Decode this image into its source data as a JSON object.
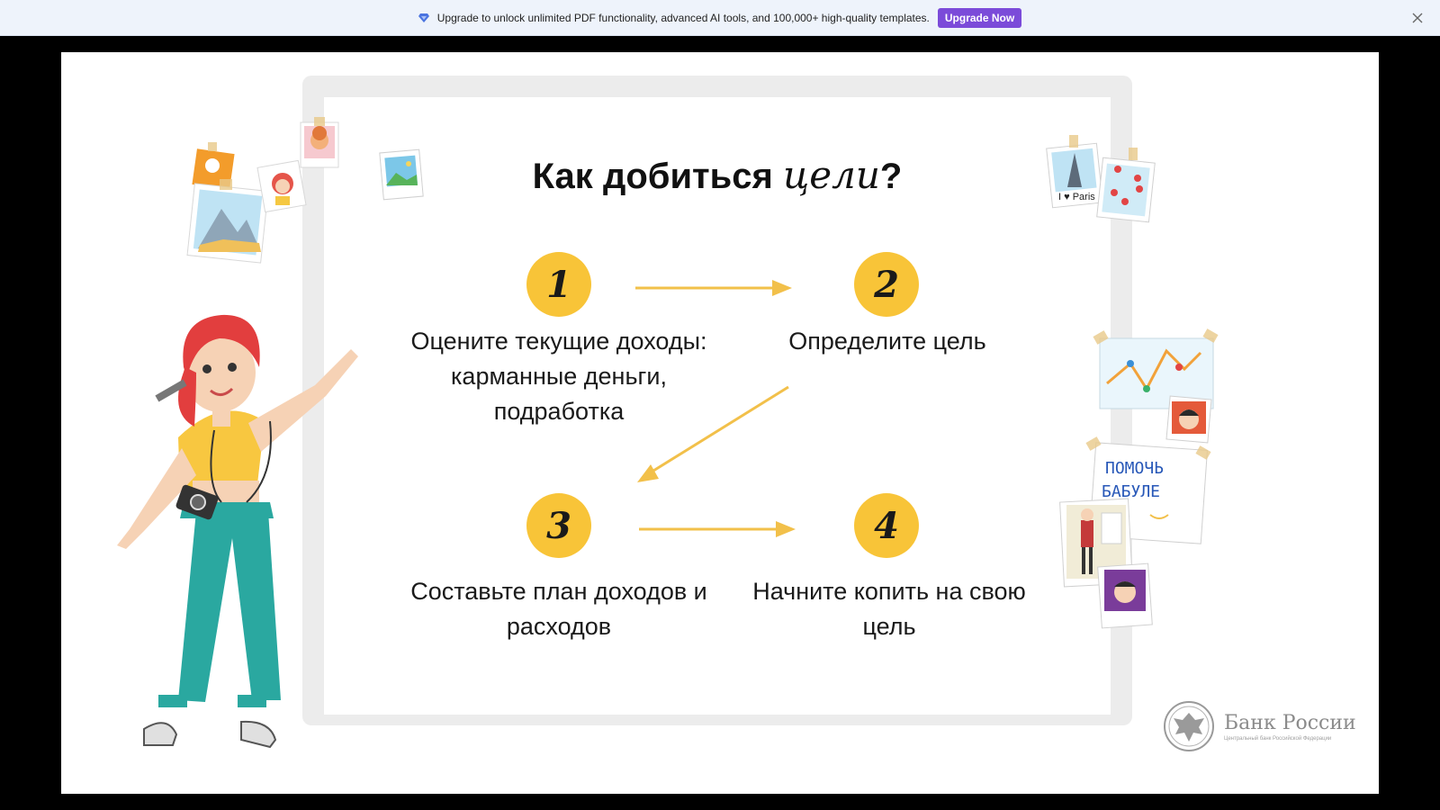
{
  "banner": {
    "message": "Upgrade to unlock unlimited PDF functionality, advanced AI tools, and 100,000+ high-quality templates.",
    "upgrade_label": "Upgrade Now",
    "gem_icon": "gem-icon",
    "close_icon": "close-icon"
  },
  "slide": {
    "title_main": "Как добиться ",
    "title_italic": "цели",
    "title_end": "?",
    "steps": [
      {
        "number": "1",
        "text": "Оцените текущие доходы: карманные деньги, подработка"
      },
      {
        "number": "2",
        "text": "Определите цель"
      },
      {
        "number": "3",
        "text": "Составьте план доходов и расходов"
      },
      {
        "number": "4",
        "text": "Начните копить на свою цель"
      }
    ],
    "note_text_line1": "ПОМОЧЬ",
    "note_text_line2": "БАБУЛЕ",
    "paris_label": "I ♥ Paris",
    "logo": {
      "name": "Банк России",
      "subtitle": "Центральный банк Российской Федерации"
    }
  },
  "colors": {
    "accent": "#f8c438",
    "banner_bg": "#eef3fb",
    "button": "#7b4bd9",
    "frame": "#ececec",
    "frame_outer": "#000000"
  }
}
